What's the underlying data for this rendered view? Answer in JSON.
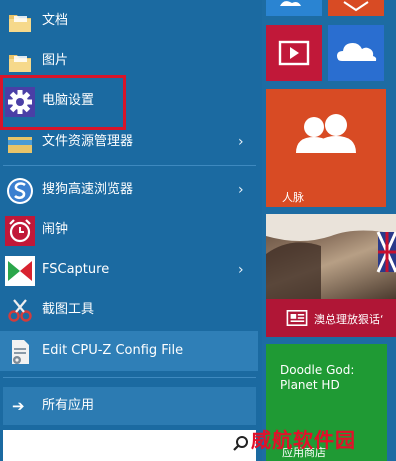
{
  "start_menu": {
    "items": [
      {
        "label": "文档",
        "icon": "folder-icon",
        "has_submenu": false
      },
      {
        "label": "图片",
        "icon": "folder-icon",
        "has_submenu": false
      },
      {
        "label": "电脑设置",
        "icon": "gear-icon",
        "has_submenu": false
      },
      {
        "label": "文件资源管理器",
        "icon": "explorer-icon",
        "has_submenu": true
      },
      {
        "label": "搜狗高速浏览器",
        "icon": "sogou-browser-icon",
        "has_submenu": true
      },
      {
        "label": "闹钟",
        "icon": "alarm-clock-icon",
        "has_submenu": false
      },
      {
        "label": "FSCapture",
        "icon": "fscapture-icon",
        "has_submenu": true
      },
      {
        "label": "截图工具",
        "icon": "snipping-tool-icon",
        "has_submenu": false
      },
      {
        "label": "Edit CPU-Z Config File",
        "icon": "config-file-icon",
        "has_submenu": false
      }
    ],
    "chevron": "›",
    "all_apps": {
      "label": "所有应用",
      "arrow": "➔"
    },
    "search": {
      "placeholder": ""
    }
  },
  "tiles": {
    "people_label": "人脉",
    "news_label": "澳总理放狠话‘",
    "game_title": "Doodle God: Planet HD",
    "store_label": "应用商店"
  },
  "watermark": "威航软件园",
  "colors": {
    "start_bg": "#1b6aa1",
    "people_tile": "#d84b24",
    "video_tile": "#c11839",
    "onedrive_tile": "#2a6ed0",
    "news_tile": "#b01636",
    "game_tile": "#1f9a34",
    "highlight_box": "#d8142a"
  }
}
